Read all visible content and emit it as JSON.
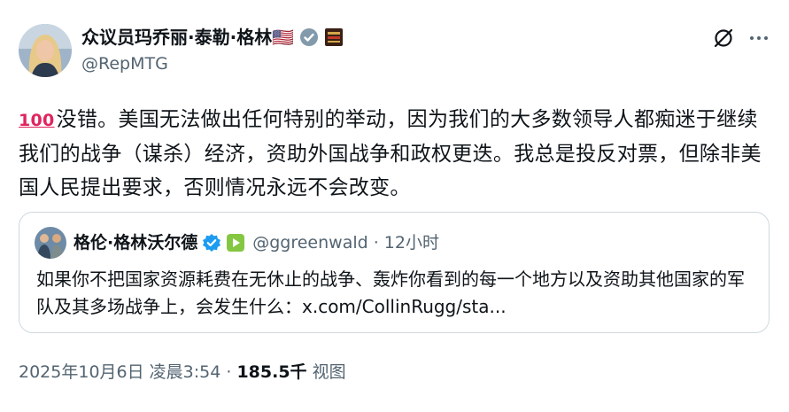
{
  "author": {
    "name": "众议员玛乔丽·泰勒·格林🇺🇸",
    "handle": "@RepMTG"
  },
  "tweet": {
    "emoji": "100",
    "text": "没错。美国无法做出任何特别的举动，因为我们的大多数领导人都痴迷于继续我们的战争（谋杀）经济，资助外国战争和政权更迭。我总是投反对票，但除非美国人民提出要求，否则情况永远不会改变。"
  },
  "quoted": {
    "name": "格伦·格林沃尔德",
    "meta": "@ggreenwald · 12小时",
    "text": "如果你不把国家资源耗费在无休止的战争、轰炸你看到的每一个地方以及资助其他国家的军队及其多场战争上，会发生什么：x.com/CollinRugg/sta..."
  },
  "footer": {
    "timestamp": "2025年10月6日 凌晨3:54",
    "separator": " · ",
    "views_count": "185.5千",
    "views_label": "视图"
  },
  "colors": {
    "verified_blue": "#1d9bf0",
    "text_primary": "#0f1419",
    "text_secondary": "#536471",
    "border": "#cfd9de"
  },
  "icons": {
    "grok": "grok-icon",
    "more": "more-icon",
    "verified": "verified-badge-icon",
    "affiliate": "affiliate-badge-icon",
    "rumble": "rumble-icon"
  }
}
